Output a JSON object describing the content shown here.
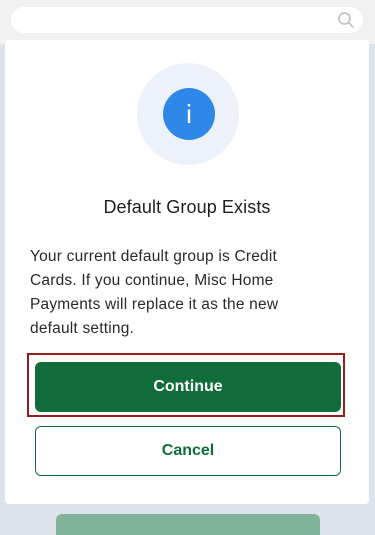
{
  "search": {
    "icon": "search-icon"
  },
  "dialog": {
    "icon": "info-icon",
    "icon_glyph": "i",
    "title": "Default Group Exists",
    "message": "Your current default group is Credit Cards. If you continue, Misc Home Payments will replace it as the new default setting.",
    "continue_label": "Continue",
    "cancel_label": "Cancel"
  },
  "colors": {
    "primary_green": "#106d3a",
    "info_blue": "#2f88e8",
    "focus_outline": "#9b1b1b"
  }
}
